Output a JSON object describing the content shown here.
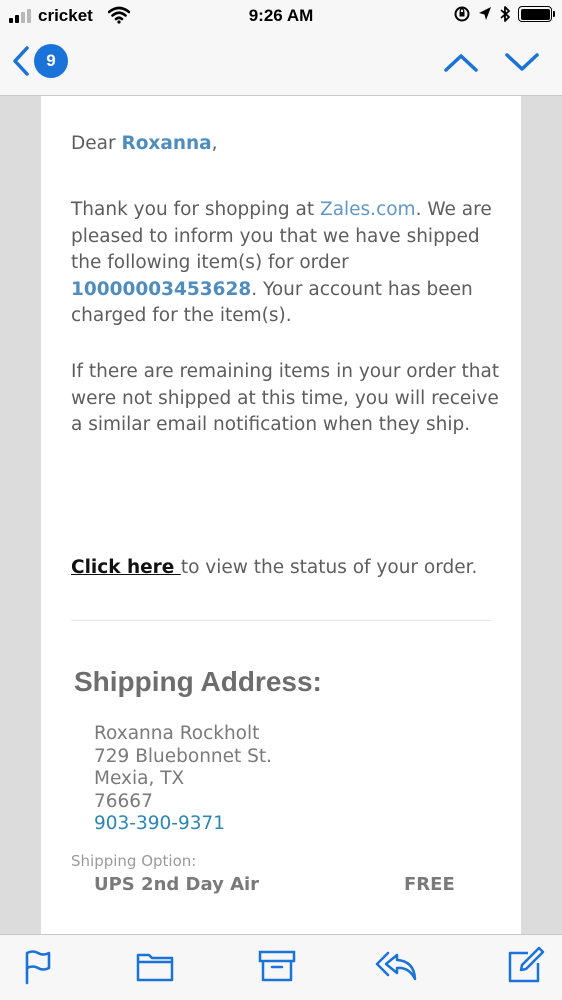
{
  "status_bar": {
    "carrier": "cricket",
    "time": "9:26 AM"
  },
  "nav": {
    "unread_count": "9"
  },
  "email": {
    "greeting_prefix": "Dear ",
    "customer_name": "Roxanna",
    "greeting_suffix": ",",
    "p1_a": "Thank you for shopping at ",
    "p1_link": "Zales.com",
    "p1_b": ". We are pleased to inform you that we have shipped the following item(s) for order ",
    "order_number": "10000003453628",
    "p1_c": ". Your account has been charged for the item(s).",
    "p2": "If there are remaining items in your order that were not shipped at this time, you will receive a similar email notification when they ship.",
    "click_here": "Click here ",
    "click_rest": "to view the status of your order.",
    "shipping_heading": "Shipping Address:",
    "address": {
      "name": "Roxanna Rockholt",
      "street": "729 Bluebonnet St.",
      "city_state": "Mexia, TX",
      "zip": "76667",
      "phone": "903-390-9371"
    },
    "shipping_option_label": "Shipping Option:",
    "shipping_method": "UPS 2nd Day Air",
    "shipping_price": "FREE"
  },
  "colors": {
    "accent": "#1a73d9",
    "link": "#5f98c6",
    "phone": "#2b87b8"
  },
  "icons": [
    "back-chevron-icon",
    "chevron-up-icon",
    "chevron-down-icon",
    "flag-icon",
    "folder-icon",
    "archive-icon",
    "reply-icon",
    "compose-icon",
    "wifi-icon",
    "location-icon",
    "bluetooth-icon",
    "battery-icon",
    "orientation-lock-icon"
  ]
}
